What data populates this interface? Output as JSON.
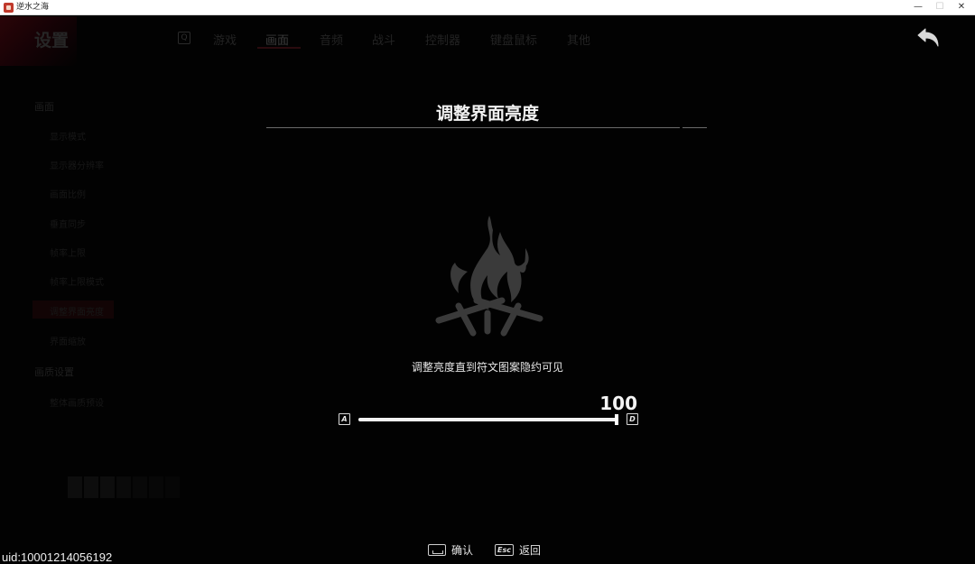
{
  "window": {
    "title": "逆水之海",
    "minimize": "—",
    "maximize": "☐",
    "close": "✕"
  },
  "background": {
    "title": "设置",
    "tabs": [
      "游戏",
      "画面",
      "音频",
      "战斗",
      "控制器",
      "键盘鼠标",
      "其他"
    ],
    "active_tab": "画面",
    "category_1": "画面",
    "items_1": [
      "显示模式",
      "显示器分辨率",
      "画面比例",
      "垂直同步",
      "帧率上限",
      "帧率上限模式",
      "调整界面亮度",
      "界面缩放"
    ],
    "category_2": "画质设置",
    "items_2": [
      "整体画质预设"
    ],
    "icons": [
      "search-icon",
      "back-arrow-icon"
    ]
  },
  "dialog": {
    "title": "调整界面亮度",
    "hint": "调整亮度直到符文图案隐约可见",
    "value": "100",
    "value_fraction": 1.0,
    "left_key": "A",
    "right_key": "D",
    "art_icon": "campfire-rune-icon"
  },
  "footer": {
    "confirm_label": "确认",
    "return_label": "返回",
    "esc_key": "Esc",
    "space_key_icon": "space-key-icon"
  },
  "uid": "uid:10001214056192",
  "colors": {
    "accent": "#2a0408",
    "text": "#f2f2f2",
    "background": "#000000"
  }
}
